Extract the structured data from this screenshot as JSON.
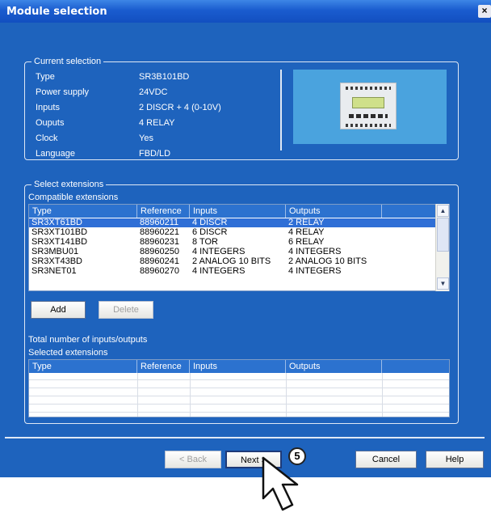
{
  "window": {
    "title": "Module selection",
    "close_glyph": "×"
  },
  "current_selection": {
    "group_title": "Current selection",
    "fields": [
      {
        "label": "Type",
        "value": "SR3B101BD"
      },
      {
        "label": "Power supply",
        "value": "24VDC"
      },
      {
        "label": "Inputs",
        "value": "2 DISCR + 4 (0-10V)"
      },
      {
        "label": "Ouputs",
        "value": "4 RELAY"
      },
      {
        "label": "Clock",
        "value": "Yes"
      },
      {
        "label": "Language",
        "value": "FBD/LD"
      }
    ]
  },
  "extensions": {
    "group_title": "Select extensions",
    "compatible_label": "Compatible extensions",
    "columns": [
      "Type",
      "Reference",
      "Inputs",
      "Outputs"
    ],
    "rows": [
      {
        "type": "SR3XT61BD",
        "reference": "88960211",
        "inputs": "4 DISCR",
        "outputs": "2 RELAY",
        "selected": true
      },
      {
        "type": "SR3XT101BD",
        "reference": "88960221",
        "inputs": "6 DISCR",
        "outputs": "4 RELAY",
        "selected": false
      },
      {
        "type": "SR3XT141BD",
        "reference": "88960231",
        "inputs": "8 TOR",
        "outputs": "6 RELAY",
        "selected": false
      },
      {
        "type": "SR3MBU01",
        "reference": "88960250",
        "inputs": "4 INTEGERS",
        "outputs": "4 INTEGERS",
        "selected": false
      },
      {
        "type": "SR3XT43BD",
        "reference": "88960241",
        "inputs": "2 ANALOG 10 BITS",
        "outputs": "2 ANALOG 10 BITS",
        "selected": false
      },
      {
        "type": "SR3NET01",
        "reference": "88960270",
        "inputs": "4 INTEGERS",
        "outputs": "4 INTEGERS",
        "selected": false
      }
    ],
    "add_label": "Add",
    "delete_label": "Delete",
    "total_label": "Total number of inputs/outputs",
    "selected_label": "Selected extensions",
    "selected_columns": [
      "Type",
      "Reference",
      "Inputs",
      "Outputs"
    ]
  },
  "footer": {
    "back_label": "< Back",
    "next_label": "Next >",
    "cancel_label": "Cancel",
    "help_label": "Help"
  },
  "callout": {
    "number": "5"
  },
  "icons": {
    "close": "close-icon",
    "scroll_up": "scroll-up-icon",
    "scroll_down": "scroll-down-icon",
    "cursor": "mouse-pointer-icon",
    "module": "module-image"
  },
  "colors": {
    "window_bg": "#1e63bd",
    "title_bar": "#1a5ccf",
    "list_header": "#2c72cf",
    "selection": "#2f6fd6",
    "preview_bg": "#4aa3de"
  }
}
